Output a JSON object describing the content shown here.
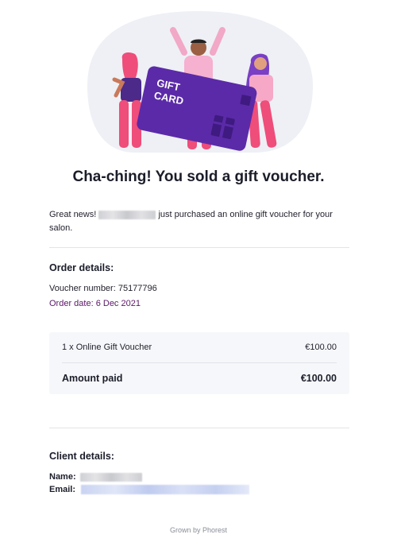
{
  "email": {
    "headline": "Cha-ching! You sold a gift voucher.",
    "intro": {
      "prefix": "Great news!",
      "suffix": "just purchased an online gift voucher for your salon."
    },
    "hero_card_text": [
      "GIFT",
      "CARD"
    ],
    "colors": {
      "purple": "#5b2aa8",
      "pink": "#ef4d7a",
      "blob": "#eef0f5",
      "date_text": "#5a1667"
    }
  },
  "order": {
    "title": "Order details:",
    "voucher_number": "Voucher number: 75177796",
    "order_date": "Order date: 6 Dec 2021",
    "item_label": "1 x Online Gift Voucher",
    "item_price": "€100.00",
    "total_label": "Amount paid",
    "total_value": "€100.00"
  },
  "client": {
    "title": "Client details:",
    "name_label": "Name:",
    "email_label": "Email:"
  },
  "footer": {
    "text": "Grown by Phorest"
  }
}
